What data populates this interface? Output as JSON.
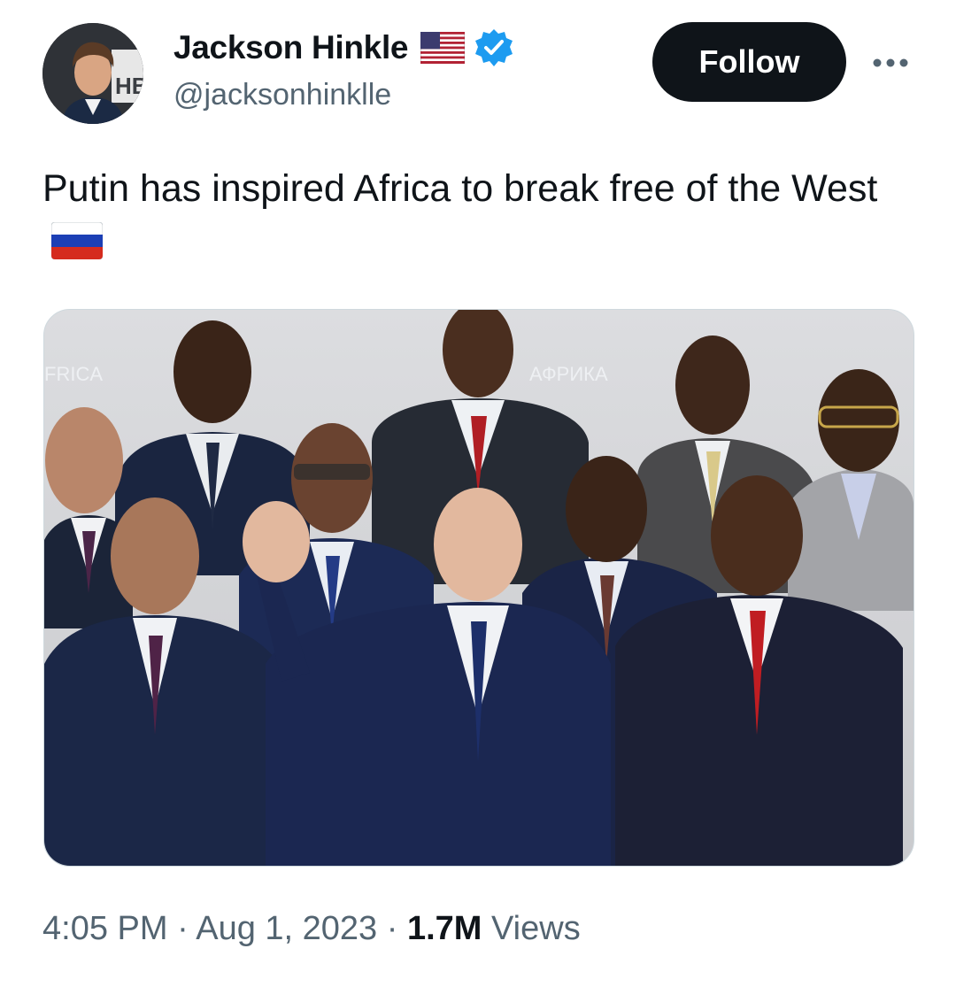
{
  "author": {
    "display_name": "Jackson Hinkle",
    "handle": "@jacksonhinklle",
    "verified": true,
    "name_emoji": "us-flag-icon",
    "avatar_text": "HB"
  },
  "actions": {
    "follow_label": "Follow",
    "more_icon": "more-options-icon"
  },
  "tweet": {
    "text": "Putin has inspired Africa to break free of the West",
    "emoji": "russia-flag-icon"
  },
  "media": {
    "backdrop_text_left": "FRICA",
    "backdrop_text_center": "АФРИКА"
  },
  "metadata": {
    "time": "4:05 PM",
    "separator": "·",
    "date": "Aug 1, 2023",
    "views_count": "1.7M",
    "views_label": "Views"
  },
  "colors": {
    "text_primary": "#0f1419",
    "text_secondary": "#536471",
    "verified_blue": "#1d9bf0",
    "follow_bg": "#0f1419"
  }
}
